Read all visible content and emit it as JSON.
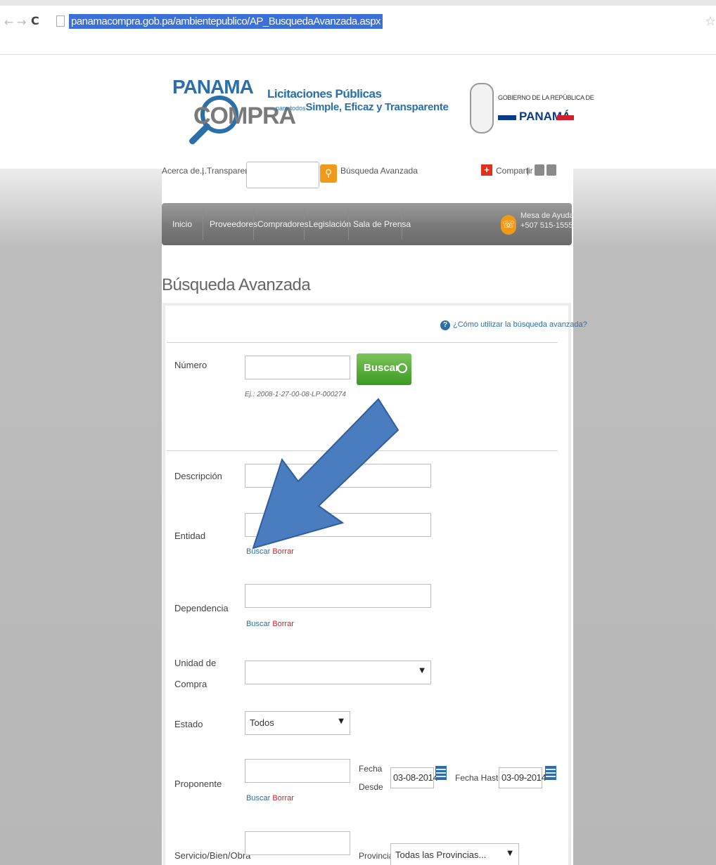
{
  "browser": {
    "url": "panamacompra.gob.pa/ambientepublico/AP_BusquedaAvanzada.aspx",
    "back_icon": "back-arrow-icon",
    "forward_icon": "forward-arrow-icon",
    "reload_icon": "reload-icon",
    "bookmark_icon": "star-icon"
  },
  "header": {
    "logo_top": "PANAMA",
    "logo_bottom": "COMPRA",
    "tagline_title": "Licitaciones Públicas",
    "tagline_small": "para todos",
    "tagline_sub": "Simple, Eficaz y Transparente",
    "gov_text": "GOBIERNO DE LA REPÚBLICA DE",
    "gov_name": "PANAMÁ"
  },
  "utility": {
    "about": "Acerca de...",
    "separator": "|",
    "transparency": "Transparencia",
    "search_placeholder": "",
    "advanced_link": "Búsqueda Avanzada",
    "share": "Compartir",
    "share_separator": "|"
  },
  "nav": {
    "items": [
      "Inicio",
      "Proveedores",
      "Compradores",
      "Legislación",
      "Sala de Prensa"
    ],
    "help_title": "Mesa de Ayuda",
    "help_phone": "+507 515-1555"
  },
  "page": {
    "title": "Búsqueda Avanzada",
    "help_link": "¿Cómo utilizar la búsqueda avanzada?"
  },
  "form": {
    "numero_label": "Número",
    "numero_value": "",
    "numero_hint": "Ej.: 2008-1-27-00-08-LP-000274",
    "buscar_button": "Buscar",
    "descripcion_label": "Descripción",
    "entidad_label": "Entidad",
    "dependencia_label": "Dependencia",
    "unidad_label_1": "Unidad de",
    "unidad_label_2": "Compra",
    "unidad_value": "",
    "estado_label": "Estado",
    "estado_value": "Todos",
    "proponente_label": "Proponente",
    "fecha_desde_label_1": "Fecha",
    "fecha_desde_label_2": "Desde",
    "fecha_desde_value": "03-08-2014",
    "fecha_hasta_label": "Fecha Hasta",
    "fecha_hasta_value": "03-09-2014",
    "servicio_label": "Servicio/Bien/Obra",
    "provincia_label": "Provincia",
    "provincia_value": "Todas las Provincias...",
    "link_buscar": "Buscar",
    "link_borrar": "Borrar"
  },
  "annotation": {
    "arrow_color": "#4a7cc0"
  }
}
